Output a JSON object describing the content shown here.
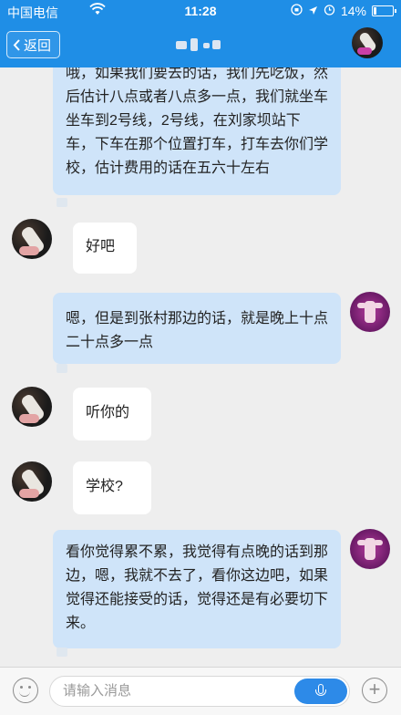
{
  "status_bar": {
    "carrier": "中国电信",
    "time": "11:28",
    "battery_percent": "14%",
    "battery_level": 0.14
  },
  "header": {
    "back_label": "返回"
  },
  "messages": [
    {
      "side": "right",
      "text": "哦，如果我们要去的话，我们先吃饭，然后估计八点或者八点多一点，我们就坐车坐车到2号线，2号线，在刘家坝站下车，下车在那个位置打车，打车去你们学校，估计费用的话在五六十左右"
    },
    {
      "side": "left",
      "text": "好吧"
    },
    {
      "side": "right",
      "text": "嗯，但是到张村那边的话，就是晚上十点二十点多一点"
    },
    {
      "side": "left",
      "text": "听你的"
    },
    {
      "side": "left",
      "text": "学校?"
    },
    {
      "side": "right",
      "text": "看你觉得累不累，我觉得有点晚的话到那边，嗯，我就不去了，看你这边吧，如果觉得还能接受的话，觉得还是有必要切下来。"
    }
  ],
  "input": {
    "placeholder": "请输入消息"
  },
  "colors": {
    "header_bg": "#1f8ee6",
    "bubble_right": "#cfe4f9",
    "bubble_left": "#ffffff",
    "background": "#eeeeee"
  },
  "icons": {
    "back": "chevron-left-icon",
    "emoji": "smiley-icon",
    "voice": "microphone-icon",
    "plus": "plus-icon"
  }
}
